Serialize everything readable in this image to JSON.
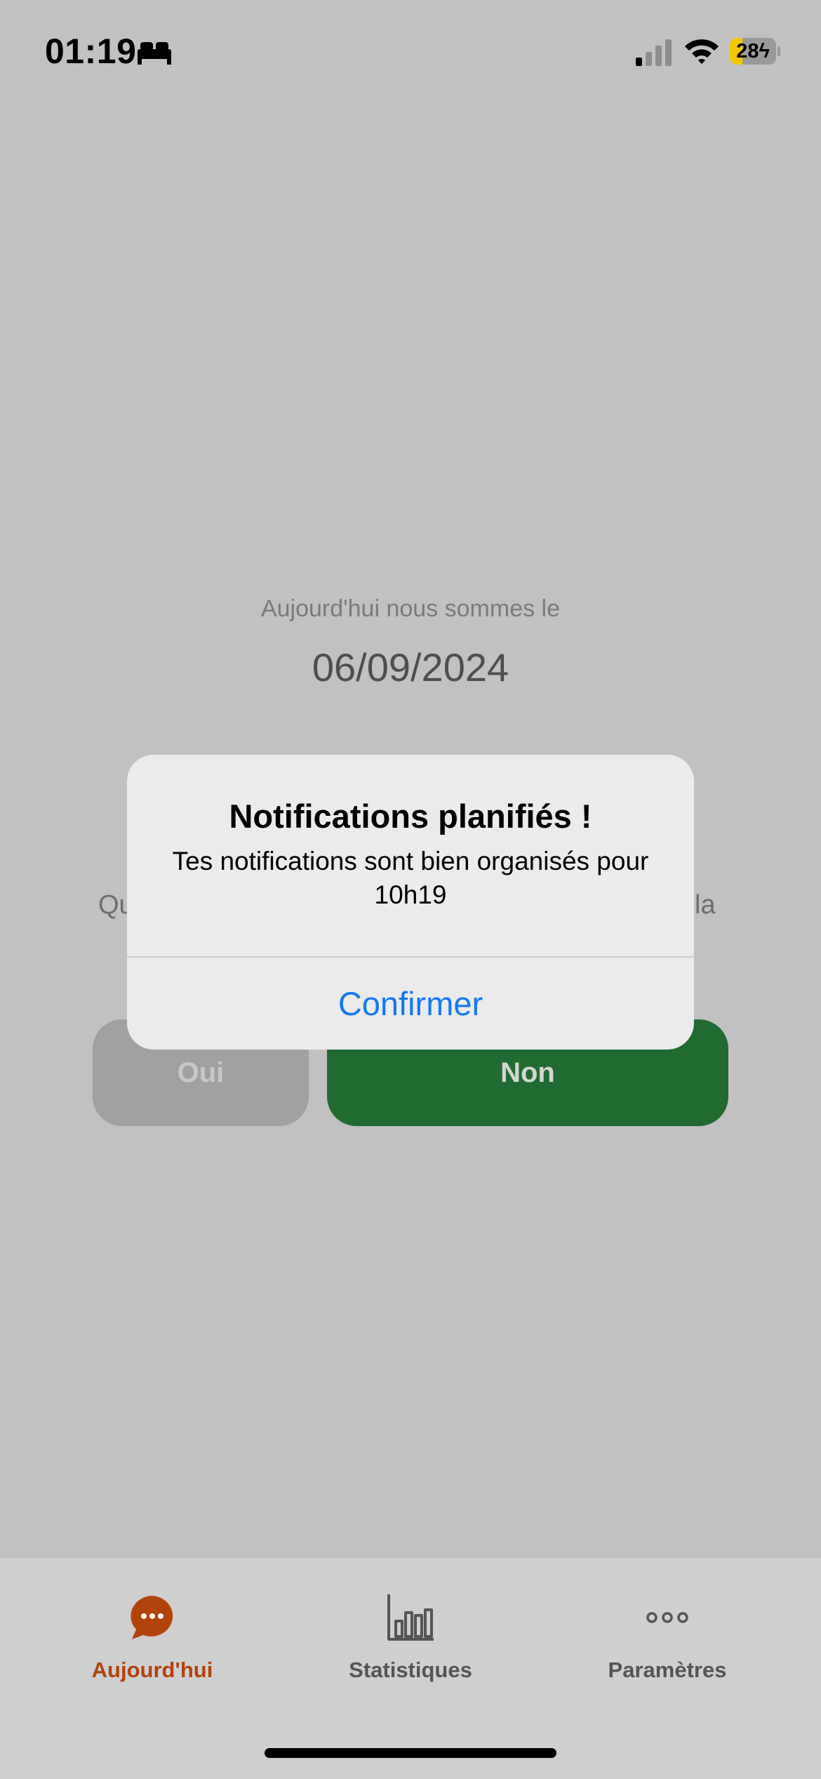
{
  "status_bar": {
    "time": "01:19",
    "focus_icon": "bed-icon",
    "signal_icon": "cellular-signal-icon",
    "wifi_icon": "wifi-icon",
    "battery_percent": "28",
    "battery_level": 0.28,
    "battery_charging": true,
    "battery_color": "#f3c800"
  },
  "main": {
    "date_caption": "Aujourd'hui nous sommes le",
    "date_value": "06/09/2024",
    "question_start": "Qu",
    "question_end": "la",
    "yes_button": "Oui",
    "no_button": "Non",
    "no_button_color": "#216a32"
  },
  "alert": {
    "title": "Notifications planifiés !",
    "message": "Tes notifications sont bien organisés pour 10h19",
    "confirm_label": "Confirmer",
    "confirm_color": "#1479f2"
  },
  "tab_bar": {
    "tabs": [
      {
        "label": "Aujourd'hui",
        "icon": "chat-bubble-icon",
        "active": true
      },
      {
        "label": "Statistiques",
        "icon": "bar-chart-icon",
        "active": false
      },
      {
        "label": "Paramètres",
        "icon": "more-dots-icon",
        "active": false
      }
    ],
    "active_color": "#b2430d",
    "inactive_color": "#555555"
  }
}
